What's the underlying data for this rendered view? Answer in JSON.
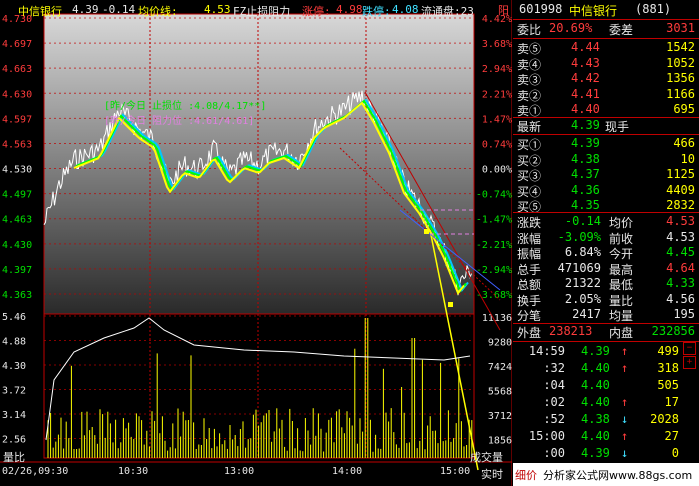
{
  "header": {
    "name": "中信银行",
    "price": "4.39",
    "change": "-0.14",
    "avg_label": "均价线:",
    "avg_value": "4.53",
    "fz_label": "FZ止损阻力",
    "limit_up_label": "涨停:",
    "limit_up_value": "4.98",
    "limit_down_label": "跌停:",
    "limit_down_value": "4.08",
    "float_label": "流通盘:23"
  },
  "chart": {
    "price_ticks_left": [
      "4.730",
      "4.697",
      "4.663",
      "4.630",
      "4.597",
      "4.563",
      "4.530",
      "4.497",
      "4.463",
      "4.430",
      "4.397",
      "4.363"
    ],
    "pct_ticks_right": [
      "4.42%",
      "3.68%",
      "2.94%",
      "2.21%",
      "1.47%",
      "0.74%",
      "0.00%",
      "-0.74%",
      "-1.47%",
      "-2.21%",
      "-2.94%",
      "-3.68%"
    ],
    "vol_ticks_left": [
      "5.46",
      "4.88",
      "4.30",
      "3.72",
      "3.14",
      "2.56"
    ],
    "vol_ticks_right": [
      "11136",
      "9280",
      "7424",
      "5568",
      "3712",
      "1856"
    ],
    "vol_label": "量比",
    "vol_right_label": "成交量",
    "time_labels": [
      "02/26,09:30",
      "10:30",
      "13:00",
      "14:00",
      "15:00"
    ],
    "realtime_label": "实时",
    "legend_line1": "[昨/今日 止损位 :4.08/4.17**]",
    "legend_line2": "[昨/今日 阻力位 :4.61/4.61]",
    "marker_label": "阳"
  },
  "panel": {
    "code": "601998",
    "name": "中信银行",
    "sub": "(881)",
    "ratio_label": "委比",
    "ratio_value": "20.69%",
    "diff_label": "委差",
    "diff_value": "3031",
    "asks": [
      {
        "label": "卖⑤",
        "price": "4.44",
        "vol": "1542"
      },
      {
        "label": "卖④",
        "price": "4.43",
        "vol": "1052"
      },
      {
        "label": "卖③",
        "price": "4.42",
        "vol": "1356"
      },
      {
        "label": "卖②",
        "price": "4.41",
        "vol": "1166"
      },
      {
        "label": "卖①",
        "price": "4.40",
        "vol": "695"
      }
    ],
    "last_label": "最新",
    "last_price": "4.39",
    "hand_label": "现手",
    "bids": [
      {
        "label": "买①",
        "price": "4.39",
        "vol": "466"
      },
      {
        "label": "买②",
        "price": "4.38",
        "vol": "10"
      },
      {
        "label": "买③",
        "price": "4.37",
        "vol": "1125"
      },
      {
        "label": "买④",
        "price": "4.36",
        "vol": "4409"
      },
      {
        "label": "买⑤",
        "price": "4.35",
        "vol": "2832"
      }
    ],
    "stats": [
      {
        "l1": "涨跌",
        "v1": "-0.14",
        "l2": "均价",
        "v2": "4.53",
        "c1": "green",
        "c2": "red"
      },
      {
        "l1": "涨幅",
        "v1": "-3.09%",
        "l2": "前收",
        "v2": "4.53",
        "c1": "green",
        "c2": "white"
      },
      {
        "l1": "振幅",
        "v1": "6.84%",
        "l2": "今开",
        "v2": "4.45",
        "c1": "white",
        "c2": "green"
      },
      {
        "l1": "总手",
        "v1": "471069",
        "l2": "最高",
        "v2": "4.64",
        "c1": "white",
        "c2": "red"
      },
      {
        "l1": "总额",
        "v1": "21322",
        "l2": "最低",
        "v2": "4.33",
        "c1": "white",
        "c2": "green"
      },
      {
        "l1": "换手",
        "v1": "2.05%",
        "l2": "量比",
        "v2": "4.56",
        "c1": "white",
        "c2": "white"
      },
      {
        "l1": "分笔",
        "v1": "2417",
        "l2": "均量",
        "v2": "195",
        "c1": "white",
        "c2": "white"
      }
    ],
    "outer_label": "外盘",
    "outer_value": "238213",
    "inner_label": "内盘",
    "inner_value": "232856",
    "ticks": [
      {
        "t": "14:59",
        "p": "4.39",
        "a": "↑",
        "v": "499",
        "c": "green",
        "ac": "red"
      },
      {
        "t": ":32",
        "p": "4.40",
        "a": "↑",
        "v": "318",
        "c": "green",
        "ac": "red"
      },
      {
        "t": ":04",
        "p": "4.40",
        "a": "",
        "v": "505",
        "c": "green",
        "ac": "red"
      },
      {
        "t": ":02",
        "p": "4.40",
        "a": "↑",
        "v": "17",
        "c": "green",
        "ac": "red"
      },
      {
        "t": ":52",
        "p": "4.38",
        "a": "↓",
        "v": "2028",
        "c": "green",
        "ac": "cyan"
      },
      {
        "t": "15:00",
        "p": "4.40",
        "a": "↑",
        "v": "27",
        "c": "green",
        "ac": "red"
      },
      {
        "t": ":00",
        "p": "4.39",
        "a": "↓",
        "v": "0",
        "c": "green",
        "ac": "cyan"
      }
    ],
    "footer_left": "细价",
    "footer_right": "分析家公式网www.88gs.com"
  }
}
